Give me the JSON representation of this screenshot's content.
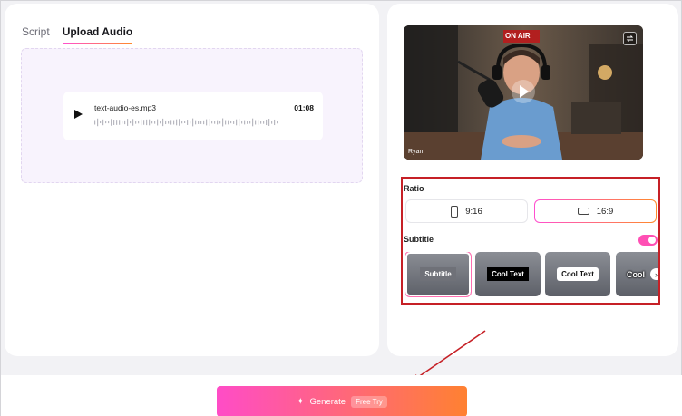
{
  "tabs": [
    "Script",
    "Upload Audio"
  ],
  "audio": {
    "file_name": "text-audio-es.mp3",
    "duration": "01:08"
  },
  "video": {
    "presenter_name": "Ryan",
    "sign_text": "ON AIR"
  },
  "ratio": {
    "label": "Ratio",
    "options": [
      "9:16",
      "16:9"
    ],
    "selected": "16:9"
  },
  "subtitle": {
    "label": "Subtitle",
    "enabled": true,
    "styles": [
      "Subtitle",
      "Cool Text",
      "Cool Text",
      "Cool"
    ],
    "selected_index": 0
  },
  "generate": {
    "label": "Generate",
    "badge": "Free Try"
  },
  "colors": {
    "accent_start": "#ff4fd0",
    "accent_end": "#ff8a2a",
    "annotation_red": "#c62026"
  }
}
